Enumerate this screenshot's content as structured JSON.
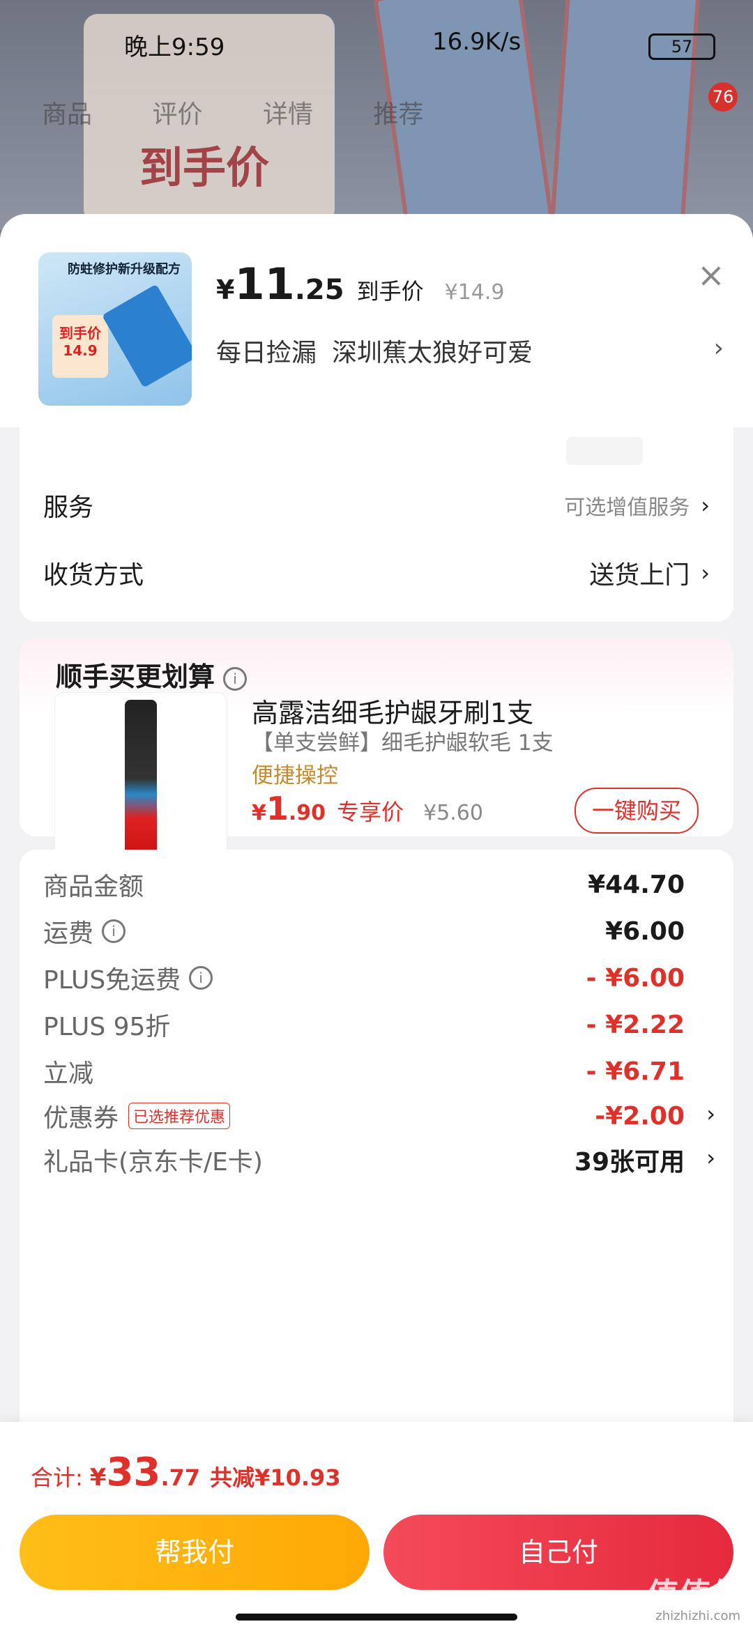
{
  "status_bar": {
    "time": "晚上9:59",
    "network": "16.9K/s",
    "battery": "57"
  },
  "bg": {
    "tabs": [
      "商品",
      "评价",
      "详情",
      "推荐"
    ],
    "poster_text": "到手价",
    "cart_count": "76"
  },
  "header": {
    "thumb_text": "防蛀修护新升级配方",
    "thumb_price": "到手价 14.9",
    "currency": "¥",
    "price_int": "11",
    "price_dec": ".25",
    "price_label": "到手价",
    "orig_price": "¥14.9",
    "shop_label": "每日捡漏",
    "shop_name": "深圳蕉太狼好可爱",
    "close": "×",
    "chevron": "›"
  },
  "options": {
    "service_label": "服务",
    "service_value": "可选增值服务",
    "delivery_label": "收货方式",
    "delivery_value": "送货上门",
    "chevron": "›"
  },
  "addon": {
    "title": "顺手买更划算",
    "info": "i",
    "product_title": "高露洁细毛护龈牙刷1支",
    "product_desc": "【单支尝鲜】细毛护龈软毛 1支",
    "product_tag": "便捷操控",
    "currency": "¥",
    "price_int": "1",
    "price_dec": ".90",
    "price_label": "专享价",
    "orig_price": "¥5.60",
    "buy_button": "一键购买"
  },
  "fees": [
    {
      "label": "商品金额",
      "value": "¥44.70",
      "red": false,
      "info": false
    },
    {
      "label": "运费",
      "value": "¥6.00",
      "red": false,
      "info": true
    },
    {
      "label": "PLUS免运费",
      "value": "- ¥6.00",
      "red": true,
      "info": true
    },
    {
      "label": "PLUS 95折",
      "value": "- ¥2.22",
      "red": true,
      "info": false
    },
    {
      "label": "立减",
      "value": "- ¥6.71",
      "red": true,
      "info": false
    },
    {
      "label": "优惠券",
      "value": "-¥2.00",
      "red": true,
      "tag": "已选推荐优惠"
    },
    {
      "label": "礼品卡(京东卡/E卡)",
      "value": "39张可用",
      "red": false
    }
  ],
  "footer": {
    "total_label": "合计:",
    "currency": "¥",
    "total_int": "33",
    "total_dec": ".77",
    "savings": "共减¥10.93",
    "help_pay": "帮我付",
    "self_pay": "自己付"
  },
  "watermark": {
    "main": "值值值",
    "sub": "zhizhizhi.com"
  }
}
